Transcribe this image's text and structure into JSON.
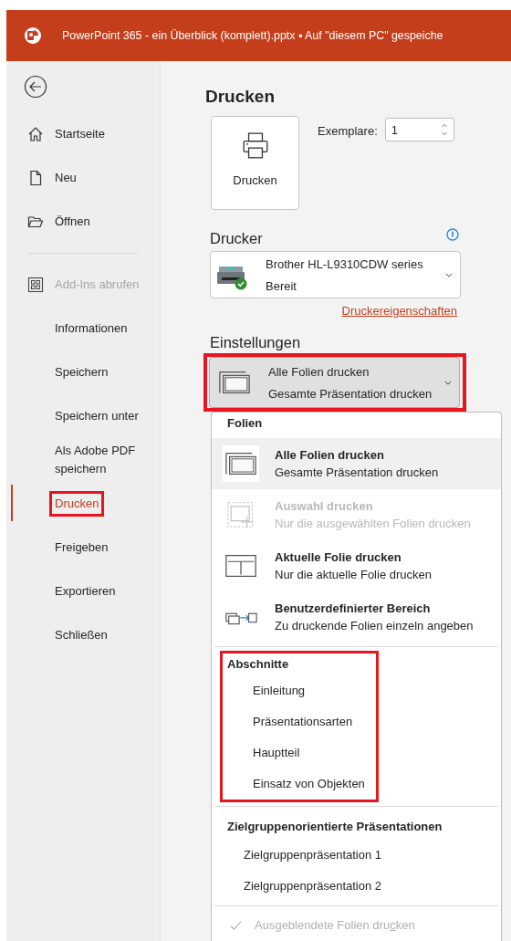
{
  "window": {
    "title": "PowerPoint 365 - ein Überblick (komplett).pptx ▪ Auf \"diesem PC\" gespeiche"
  },
  "sidebar": {
    "primary_items": [
      {
        "label": "Startseite",
        "kind": "home",
        "disabled": false,
        "selected": false,
        "highlighted": false
      },
      {
        "label": "Neu",
        "kind": "page",
        "disabled": false,
        "selected": false,
        "highlighted": false
      },
      {
        "label": "Öffnen",
        "kind": "folder",
        "disabled": false,
        "selected": false,
        "highlighted": false
      }
    ],
    "items": [
      {
        "label": "Add-Ins abrufen",
        "kind": "grid",
        "disabled": true,
        "selected": false,
        "highlighted": false
      },
      {
        "label": "Informationen",
        "disabled": false,
        "selected": false,
        "highlighted": false
      },
      {
        "label": "Speichern",
        "disabled": false,
        "selected": false,
        "highlighted": false
      },
      {
        "label": "Speichern unter",
        "disabled": false,
        "selected": false,
        "highlighted": false
      },
      {
        "label": "Als Adobe PDF speichern",
        "disabled": false,
        "selected": false,
        "highlighted": false
      },
      {
        "label": "Drucken",
        "disabled": false,
        "selected": true,
        "highlighted": true
      },
      {
        "label": "Freigeben",
        "disabled": false,
        "selected": false,
        "highlighted": false
      },
      {
        "label": "Exportieren",
        "disabled": false,
        "selected": false,
        "highlighted": false
      },
      {
        "label": "Schließen",
        "disabled": false,
        "selected": false,
        "highlighted": false
      }
    ]
  },
  "heading": "Drucken",
  "print_button": {
    "label": "Drucken"
  },
  "copies": {
    "label": "Exemplare:",
    "value": "1"
  },
  "printer": {
    "heading": "Drucker",
    "name": "Brother HL-L9310CDW series",
    "status": "Bereit",
    "ready": true,
    "properties_link": "Druckereigenschaften"
  },
  "settings": {
    "heading": "Einstellungen",
    "dropdown": {
      "kind": "all",
      "title": "Alle Folien drucken",
      "subtitle": "Gesamte Präsentation drucken",
      "expanded": true,
      "highlighted": true
    },
    "menu": {
      "sections": [
        {
          "heading": "Folien",
          "highlighted": false,
          "items": [
            {
              "kind": "all",
              "title": "Alle Folien drucken",
              "subtitle": "Gesamte Präsentation drucken",
              "selected": true,
              "disabled": false
            },
            {
              "kind": "selection",
              "title": "Auswahl drucken",
              "subtitle": "Nur die ausgewählten Folien drucken",
              "selected": false,
              "disabled": true
            },
            {
              "kind": "current",
              "title": "Aktuelle Folie drucken",
              "subtitle": "Nur die aktuelle Folie drucken",
              "selected": false,
              "disabled": false
            },
            {
              "kind": "custom",
              "title": "Benutzerdefinierter Bereich",
              "subtitle": "Zu druckende Folien einzeln angeben",
              "selected": false,
              "disabled": false
            }
          ]
        },
        {
          "heading": "Abschnitte",
          "highlighted": true,
          "items": [
            {
              "kind": "plain",
              "title": "Einleitung",
              "selected": false,
              "disabled": false
            },
            {
              "kind": "plain",
              "title": "Präsentationsarten",
              "selected": false,
              "disabled": false
            },
            {
              "kind": "plain",
              "title": "Hauptteil",
              "selected": false,
              "disabled": false
            },
            {
              "kind": "plain",
              "title": "Einsatz von Objekten",
              "selected": false,
              "disabled": false
            }
          ]
        },
        {
          "heading": "Zielgruppenorientierte Präsentationen",
          "highlighted": false,
          "items": [
            {
              "kind": "plain",
              "title": "Zielgruppenpräsentation 1",
              "selected": false,
              "disabled": false
            },
            {
              "kind": "plain",
              "title": "Zielgruppenpräsentation 2",
              "selected": false,
              "disabled": false
            }
          ]
        }
      ],
      "hidden_slides": {
        "label_start": "Ausgeblendete Folien dru",
        "access_key": "c",
        "label_end": "ken",
        "checked": true,
        "disabled": true
      }
    }
  }
}
